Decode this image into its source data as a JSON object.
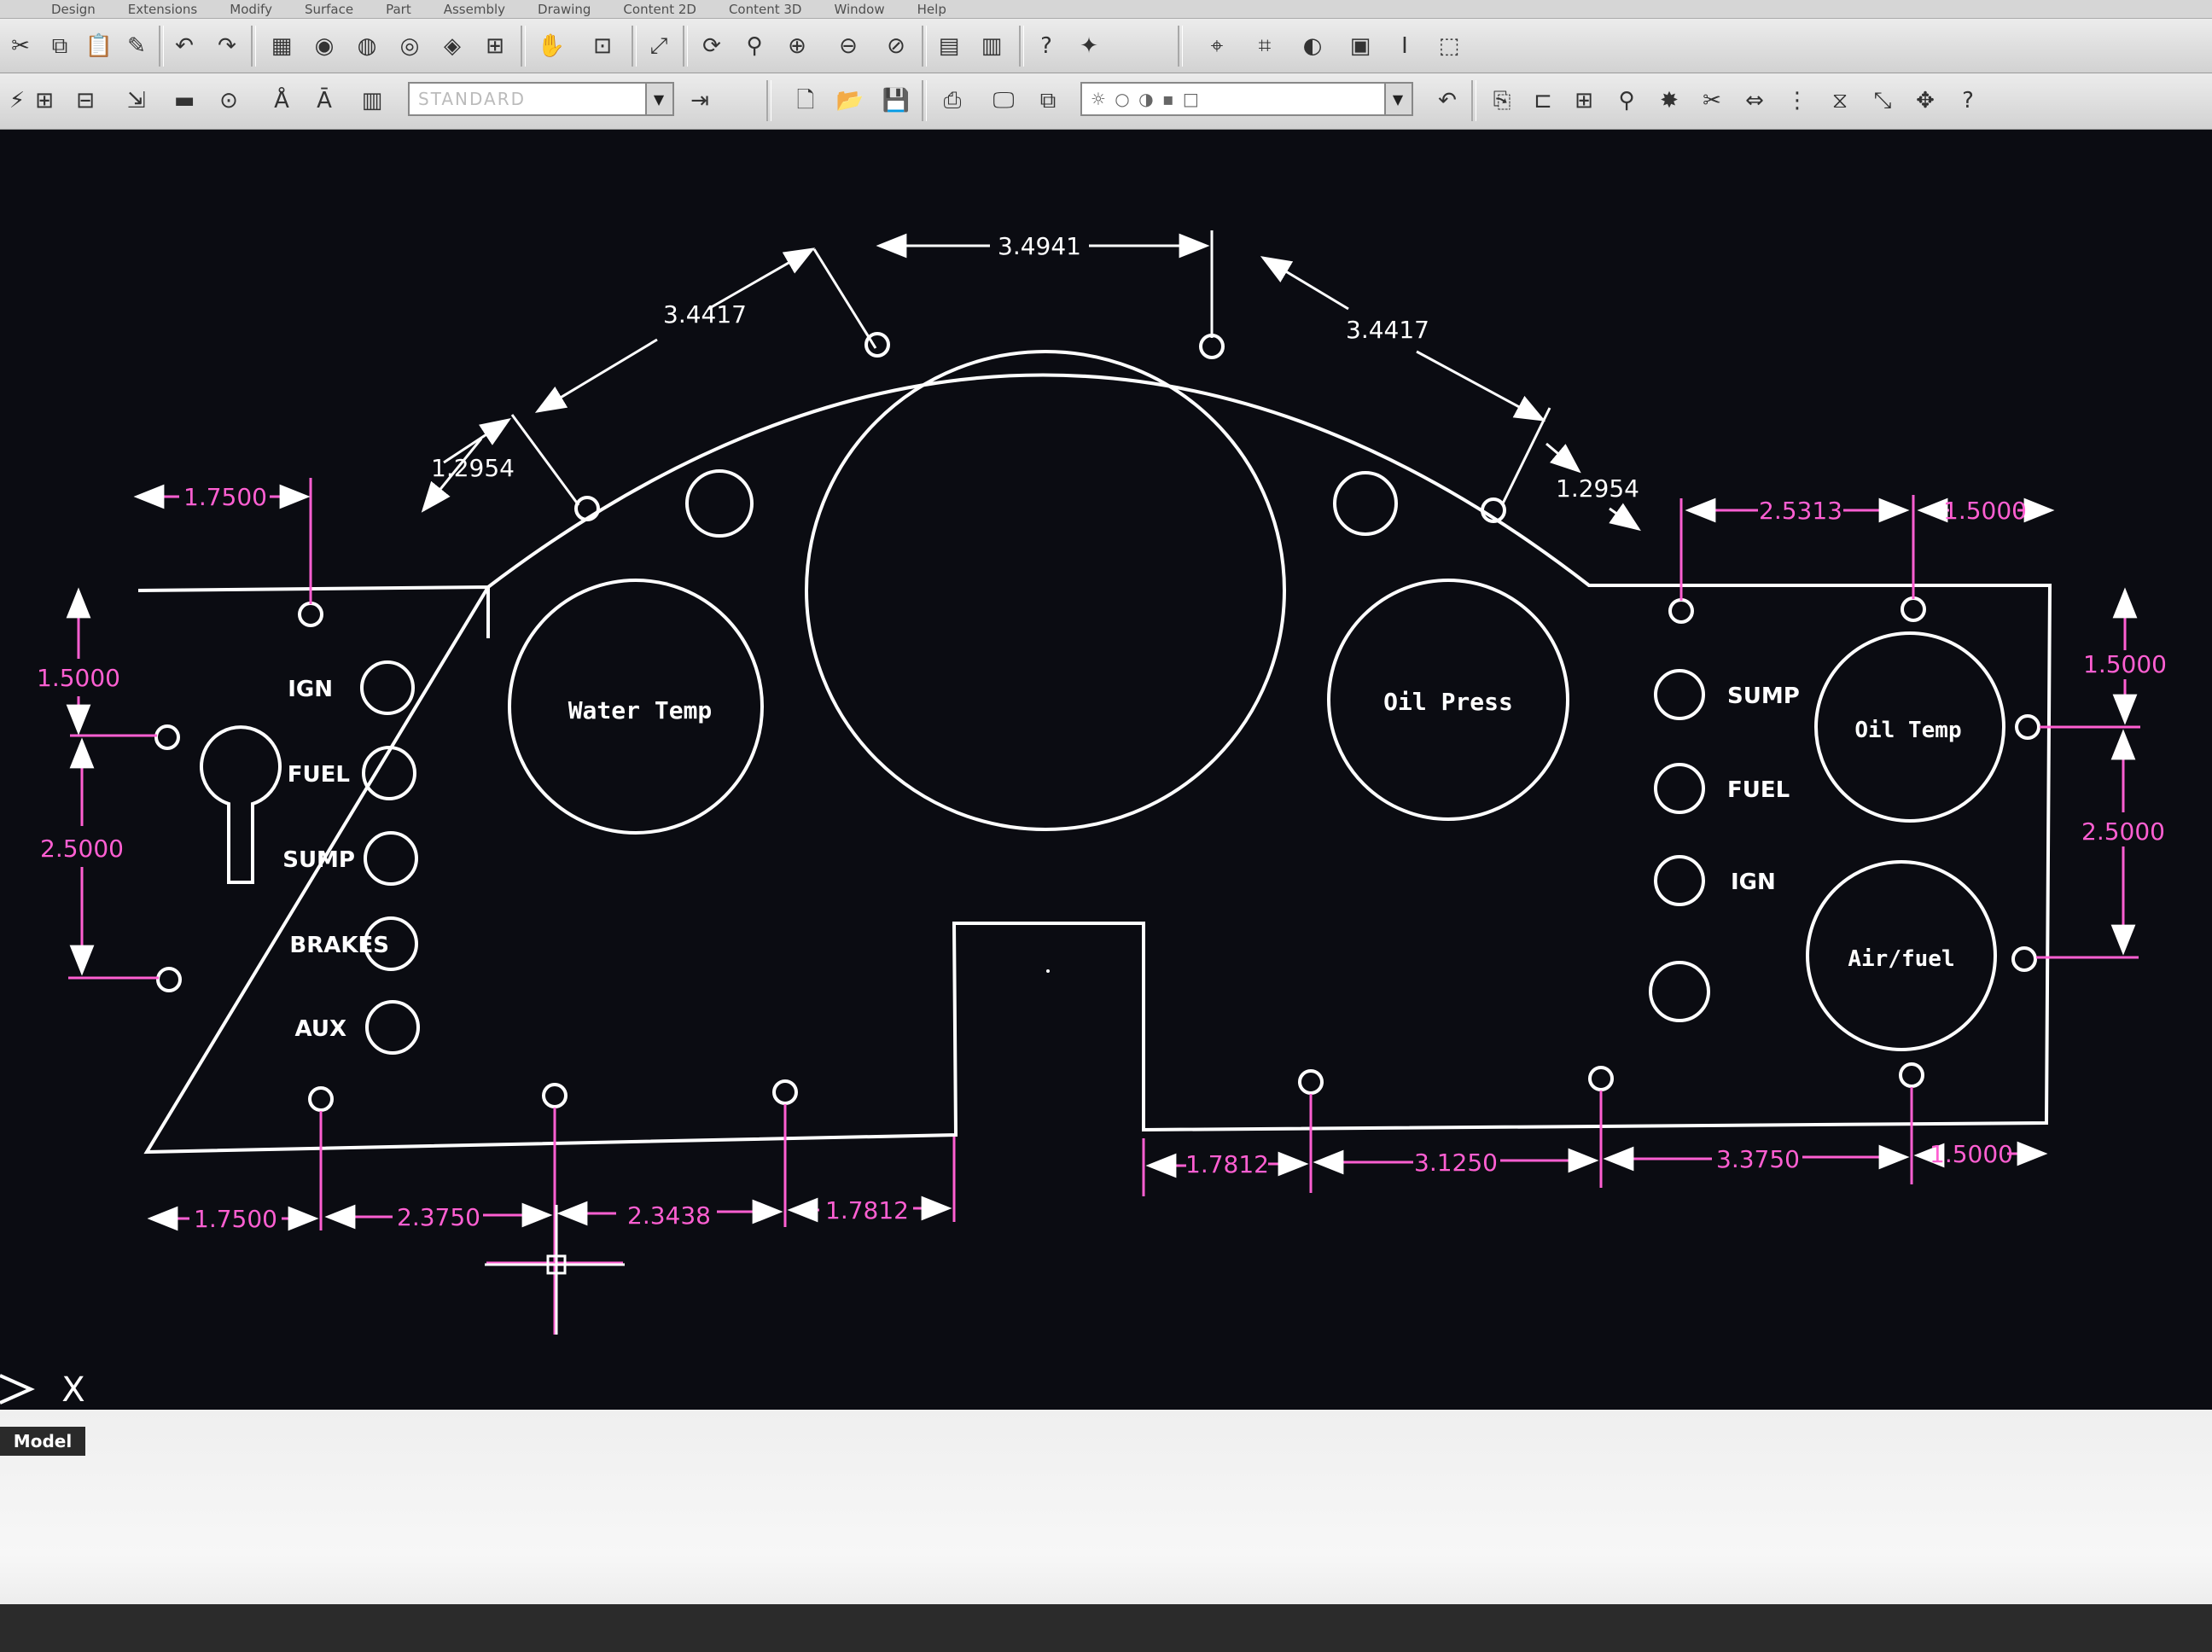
{
  "menu": [
    "Design",
    "Extensions",
    "Modify",
    "Surface",
    "Part",
    "Assembly",
    "Drawing",
    "Content 2D",
    "Content 3D",
    "Window",
    "Help"
  ],
  "toolbar": {
    "text_style_value": "STANDARD",
    "help_glyph": "?"
  },
  "drawing": {
    "gauges": {
      "water_temp": "Water Temp",
      "oil_press": "Oil Press",
      "oil_temp": "Oil Temp",
      "air_fuel": "Air/fuel"
    },
    "left_lights": [
      "IGN",
      "FUEL",
      "SUMP",
      "BRAKES",
      "AUX"
    ],
    "right_lights": [
      "SUMP",
      "FUEL",
      "IGN"
    ],
    "dims": {
      "arc_top": "3.4941",
      "arc_left": "3.4417",
      "arc_right": "3.4417",
      "edge_left": "1.2954",
      "edge_right": "1.2954",
      "top_left_offset": "1.7500",
      "top_right_a": "2.5313",
      "top_right_b": "1.5000",
      "left_vert_top": "1.5000",
      "left_vert_mid": "2.5000",
      "right_vert_top": "1.5000",
      "right_vert_mid": "2.5000",
      "bottom_left": [
        "1.7500",
        "2.3750",
        "2.3438",
        "1.7812"
      ],
      "bottom_right": [
        "1.7812",
        "3.1250",
        "3.3750",
        "1.5000"
      ]
    },
    "colors": {
      "geometry": "#ffffff",
      "dimension": "#ff5fd2",
      "background": "#0b0c12"
    }
  },
  "status": {
    "model_tab": "Model",
    "command_prompt_icon": "command-prompt-icon",
    "close_glyph": "X"
  }
}
